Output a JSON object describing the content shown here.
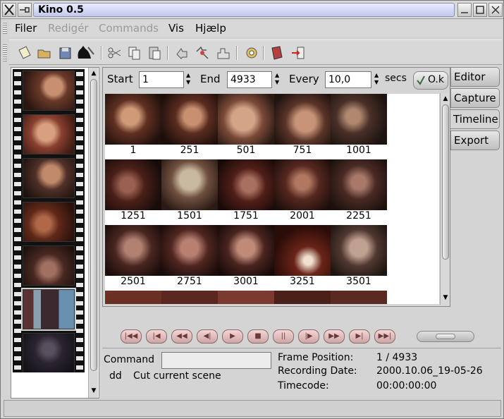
{
  "window": {
    "title": "Kino 0.5",
    "left_icon": "x-logo-icon",
    "pin_icon": "pin-icon",
    "buttons": [
      "minimize-icon",
      "maximize-icon",
      "close-icon"
    ]
  },
  "menu": [
    {
      "label": "Filer",
      "enabled": true
    },
    {
      "label": "Redigér",
      "enabled": false
    },
    {
      "label": "Commands",
      "enabled": false
    },
    {
      "label": "Vis",
      "enabled": true
    },
    {
      "label": "Hjælp",
      "enabled": true
    }
  ],
  "toolbar": [
    {
      "icon": "new-file-icon"
    },
    {
      "icon": "open-folder-icon"
    },
    {
      "icon": "save-disk-icon"
    },
    {
      "icon": "split-scene-icon"
    },
    {
      "icon": "cut-icon"
    },
    {
      "icon": "copy-icon"
    },
    {
      "icon": "paste-icon"
    },
    {
      "icon": "undo-icon"
    },
    {
      "icon": "redo-icon"
    },
    {
      "icon": "preferences-icon"
    },
    {
      "icon": "help-book-icon"
    },
    {
      "icon": "exit-icon"
    }
  ],
  "timeline": {
    "start_label": "Start",
    "start_value": "1",
    "end_label": "End",
    "end_value": "4933",
    "every_label": "Every",
    "every_value": "10,0",
    "unit_label": "secs",
    "ok_label": "O.k",
    "frames": [
      "1",
      "251",
      "501",
      "751",
      "1001",
      "1251",
      "1501",
      "1751",
      "2001",
      "2251",
      "2501",
      "2751",
      "3001",
      "3251",
      "3501"
    ]
  },
  "tabs": [
    {
      "label": "Editor",
      "active": false
    },
    {
      "label": "Capture",
      "active": false
    },
    {
      "label": "Timeline",
      "active": true
    },
    {
      "label": "Export",
      "active": false
    }
  ],
  "transport": [
    {
      "icon": "start-icon"
    },
    {
      "icon": "previous-scene-icon"
    },
    {
      "icon": "rewind-icon"
    },
    {
      "icon": "step-back-icon"
    },
    {
      "icon": "play-icon"
    },
    {
      "icon": "stop-icon"
    },
    {
      "icon": "pause-icon"
    },
    {
      "icon": "step-forward-icon"
    },
    {
      "icon": "fast-forward-icon"
    },
    {
      "icon": "next-scene-icon"
    },
    {
      "icon": "end-icon"
    }
  ],
  "status": {
    "command_label": "Command",
    "command_value": "",
    "command_key": "dd",
    "command_desc": "Cut current scene",
    "frame_position_label": "Frame Position:",
    "frame_position_value": "1 / 4933",
    "recording_date_label": "Recording Date:",
    "recording_date_value": "2000.10.06_19-05-26",
    "timecode_label": "Timecode:",
    "timecode_value": "00:00:00:00"
  }
}
